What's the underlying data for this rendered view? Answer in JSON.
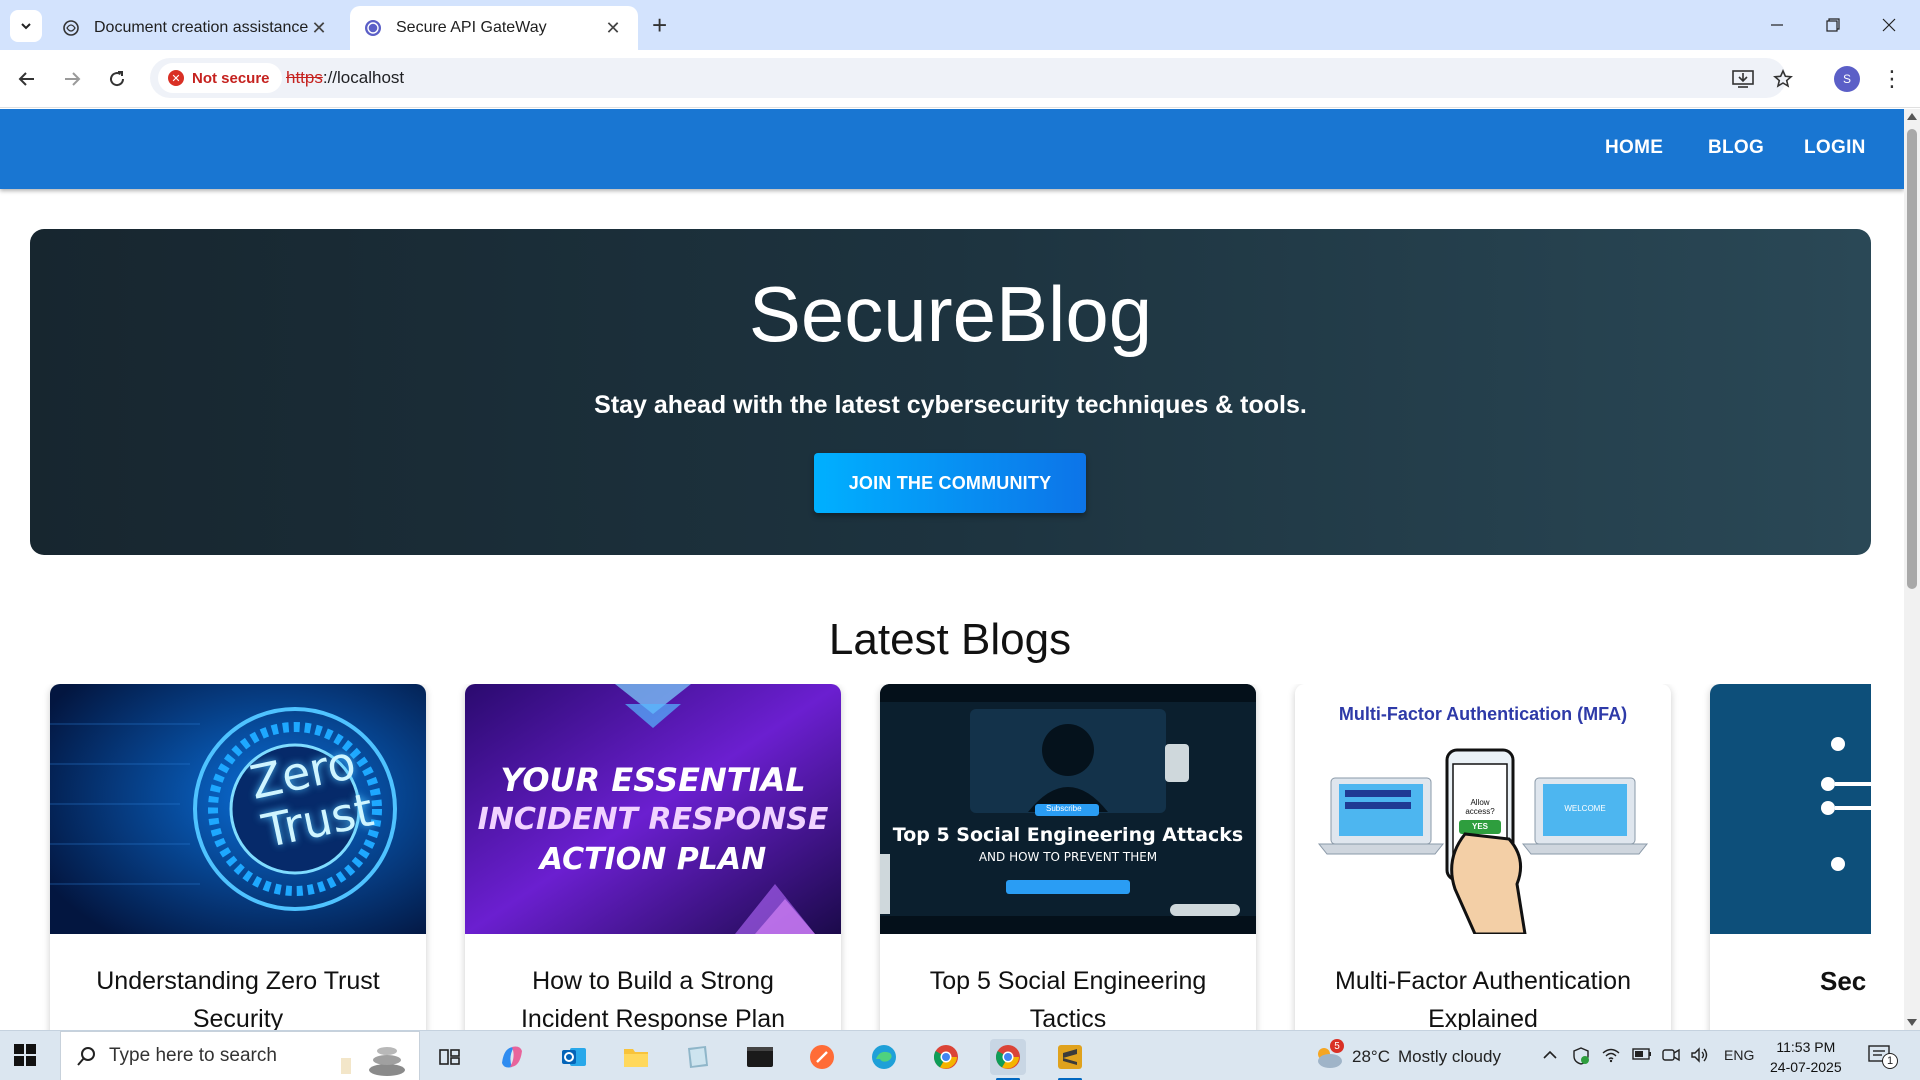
{
  "browser": {
    "tabs": [
      {
        "title": "Document creation assistance",
        "active": false
      },
      {
        "title": "Secure API GateWay",
        "active": true
      }
    ],
    "security_chip": "Not secure",
    "url_scheme": "https",
    "url_rest": "://localhost",
    "profile_initial": "S"
  },
  "site": {
    "nav": [
      "HOME",
      "BLOG",
      "LOGIN"
    ],
    "hero": {
      "title": "SecureBlog",
      "subtitle": "Stay ahead with the latest cybersecurity techniques & tools.",
      "cta": "JOIN THE COMMUNITY"
    },
    "section_title": "Latest Blogs",
    "cards": [
      {
        "title": "Understanding Zero Trust Security",
        "image_text": [
          "Zero",
          "Trust"
        ]
      },
      {
        "title": "How to Build a Strong Incident Response Plan",
        "image_text": [
          "YOUR ESSENTIAL",
          "INCIDENT RESPONSE",
          "ACTION PLAN"
        ]
      },
      {
        "title": "Top 5 Social Engineering Tactics",
        "image_text": [
          "Top 5 Social Engineering Attacks",
          "AND HOW TO PREVENT THEM",
          "Subscribe"
        ]
      },
      {
        "title": "Multi-Factor Authentication Explained",
        "image_text": [
          "Multi-Factor Authentication (MFA)",
          "Allow access?",
          "YES",
          "WELCOME"
        ]
      },
      {
        "title": "Sec"
      }
    ]
  },
  "taskbar": {
    "search_placeholder": "Type here to search",
    "weather_temp": "28°C",
    "weather_desc": "Mostly cloudy",
    "weather_badge": "5",
    "language": "ENG",
    "time": "11:53 PM",
    "date": "24-07-2025",
    "notification_count": "1"
  },
  "colors": {
    "nav_blue": "#1976d2",
    "hero_dark": "#17262f",
    "cta_blue": "#00b0ff"
  }
}
